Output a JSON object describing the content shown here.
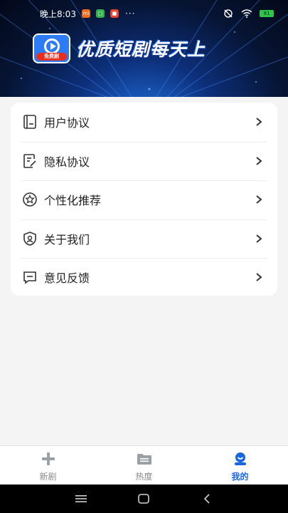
{
  "status_bar": {
    "time": "晚上8:03",
    "more": "···",
    "battery": "91"
  },
  "banner": {
    "logo_tag": "免费剧",
    "slogan": "优质短剧每天上"
  },
  "menu": {
    "items": [
      {
        "label": "用户协议",
        "icon": "document-icon"
      },
      {
        "label": "隐私协议",
        "icon": "edit-document-icon"
      },
      {
        "label": "个性化推荐",
        "icon": "star-badge-icon"
      },
      {
        "label": "关于我们",
        "icon": "shield-user-icon"
      },
      {
        "label": "意见反馈",
        "icon": "message-icon"
      }
    ]
  },
  "tabbar": {
    "tabs": [
      {
        "label": "新剧",
        "icon": "plus-icon",
        "active": false
      },
      {
        "label": "热度",
        "icon": "folder-icon",
        "active": false
      },
      {
        "label": "我的",
        "icon": "profile-icon",
        "active": true
      }
    ]
  },
  "colors": {
    "accent": "#1a66e0",
    "inactive": "#8a8a8a",
    "banner_dark": "#061433"
  }
}
